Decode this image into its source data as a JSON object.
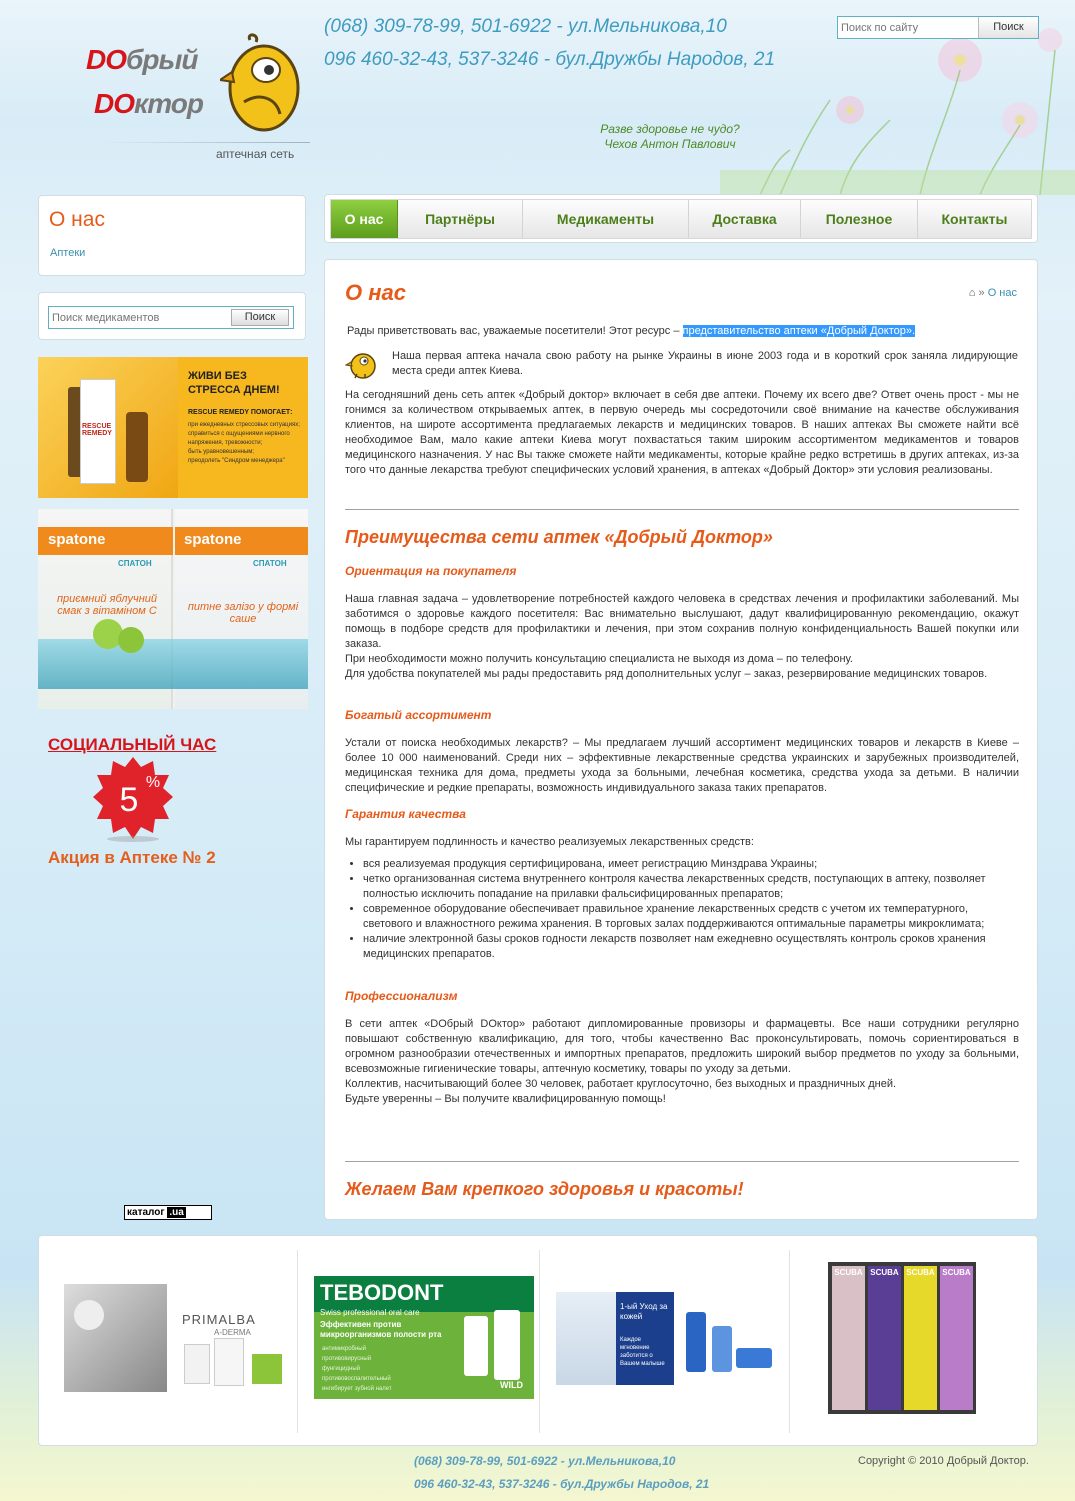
{
  "header": {
    "logo": {
      "line1_do": "DO",
      "line1_rest": "брый",
      "line2_do": "DO",
      "line2_rest": "ктор",
      "tagline": "аптечная сеть"
    },
    "phone_line1": "(068) 309-78-99, 501-6922 - ул.Мельникова,10",
    "phone_line2": "096 460-32-43, 537-3246 - бул.Дружбы Народов, 21",
    "quote_line1": "Разве здоровье не чудо?",
    "quote_line2": "Чехов Антон Павлович",
    "search": {
      "placeholder": "Поиск по сайту",
      "button": "Поиск"
    }
  },
  "nav": {
    "items": [
      {
        "label": "О нас",
        "active": true
      },
      {
        "label": "Партнёры"
      },
      {
        "label": "Медикаменты"
      },
      {
        "label": "Доставка"
      },
      {
        "label": "Полезное"
      },
      {
        "label": "Контакты"
      }
    ]
  },
  "sidebar": {
    "about_title": "О нас",
    "about_link": "Аптеки",
    "med_search": {
      "placeholder": "Поиск медикаментов",
      "button": "Поиск"
    },
    "rescue_banner": {
      "headline": "ЖИВИ БЕЗ СТРЕССА ДНЕМ!",
      "subhead": "RESCUE REMEDY ПОМОГАЕТ:",
      "bullets": [
        "при ежедневных стрессовых ситуациях;",
        "справиться с ощущениями нервного напряжения, тревожности;",
        "быть уравновешенным;",
        "преодолеть \"Синдром менеджера\""
      ],
      "pack_text": "RESCUE REMEDY"
    },
    "spatone_banner": {
      "brand": "spatone",
      "brand_cyr": "СПАТОН",
      "pack1": "приємний яблучний смак з вітаміном С",
      "pack2": "питне залізо у формі саше"
    },
    "social_title": "СОЦИАЛЬНЫЙ ЧАС",
    "discount_value": "5",
    "discount_unit": "%",
    "promo": "Акция в Аптеке № 2",
    "katalog": {
      "text": "каталог",
      "ua": ".ua"
    }
  },
  "content": {
    "title": "О нас",
    "breadcrumb_current": "О нас",
    "intro_plain": "Рады приветствовать вас, уважаемые посетители! Этот ресурс – ",
    "intro_highlight": "представительство аптеки «Добрый Доктор».",
    "first_pharmacy": "Наша первая аптека начала свою работу на рынке Украины в июне 2003 года и в короткий срок заняла лидирующие места среди аптек Киева.",
    "today": "На сегодняшний день сеть аптек «Добрый доктор» включает в себя две аптеки. Почему их всего две? Ответ очень прост - мы не гонимся за количеством открываемых аптек, в первую очередь мы сосредоточили своё внимание на качестве обслуживания клиентов, на широте ассортимента предлагаемых лекарств и медицинских товаров. В наших аптеках Вы сможете найти всё необходимое Вам, мало какие аптеки Киева могут похвастаться таким широким ассортиментом медикаментов и товаров медицинского назначения. У нас Вы также сможете найти медикаменты, которые крайне редко встретишь в других аптеках, из-за того что данные лекарства требуют специфических условий хранения, в аптеках «Добрый Доктор» эти условия реализованы.",
    "advantages_title": "Преимущества сети аптек «Добрый Доктор»",
    "s1_title": "Ориентация на покупателя",
    "s1_p1": "Наша главная задача – удовлетворение потребностей каждого человека в средствах лечения и профилактики заболеваний. Мы заботимся о здоровье каждого посетителя: Вас внимательно выслушают, дадут квалифицированную рекомендацию, окажут помощь в подборе средств для профилактики и лечения, при этом сохранив полную конфиденциальность Вашей покупки или заказа.",
    "s1_p2": "При необходимости можно получить консультацию специалиста не выходя из дома – по телефону.",
    "s1_p3": "Для удобства покупателей мы рады предоставить ряд дополнительных услуг – заказ, резервирование медицинских товаров.",
    "s2_title": "Богатый ассортимент",
    "s2_p1": "Устали от поиска необходимых лекарств? – Мы предлагаем лучший ассортимент медицинских товаров и лекарств в Киеве – более 10 000 наименований. Среди них – эффективные лекарственные средства украинских и зарубежных производителей, медицинская техника для дома, предметы ухода за больными, лечебная косметика, средства ухода за детьми. В наличии специфические и редкие препараты, возможность индивидуального заказа таких препаратов.",
    "s3_title": "Гарантия качества",
    "s3_p1": "Мы гарантируем подлинность и качество реализуемых лекарственных средств:",
    "s3_list": [
      "вся реализуемая продукция сертифицирована, имеет регистрацию Минздрава Украины;",
      "четко организованная система внутреннего контроля качества лекарственных средств, поступающих в аптеку, позволяет полностью исключить попадание на прилавки фальсифицированных препаратов;",
      "современное оборудование обеспечивает правильное хранение лекарственных средств с учетом их температурного, светового и влажностного режима хранения. В торговых залах поддерживаются оптимальные параметры микроклимата;",
      "наличие электронной базы сроков годности лекарств позволяет нам ежедневно осуществлять контроль сроков хранения медицинских препаратов."
    ],
    "s4_title": "Профессионализм",
    "s4_p1": "В сети аптек «DOбрый DOктор» работают дипломированные провизоры и фармацевты. Все наши сотрудники регулярно повышают собственную квалификацию, для того, чтобы качественно Вас проконсультировать, помочь сориентироваться в огромном разнообразии отечественных и импортных препаратов, предложить широкий выбор предметов по уходу за больными, всевозможные гигиенические товары, аптечную косметику, товары по уходу за детьми.",
    "s4_p2": "Коллектив, насчитывающий более 30 человек, работает круглосуточно, без выходных и праздничных дней.",
    "s4_p3": "Будьте уверенны – Вы получите квалифицированную помощь!",
    "closing": "Желаем Вам крепкого здоровья и красоты!"
  },
  "partners": {
    "primalba": {
      "brand": "PRIMALBA",
      "sub": "A-DERMA"
    },
    "tebodont": {
      "brand": "TEBODONT",
      "tag": "Swiss professional oral care",
      "headline": "Эффективен против микроорганизмов полости рта",
      "bullets": [
        "антимикробный",
        "противовирусный",
        "фунгицидный",
        "противовоспалительный",
        "ингибирует зубной налет"
      ],
      "wild": "WILD"
    },
    "baby": {
      "text1": "1-ый Уход за кожей",
      "text2": "Каждое мгновение заботится о Вашем малыше"
    },
    "scuba": {
      "brand": "SCUBA",
      "count": 4
    }
  },
  "footer": {
    "phone_line1": "(068) 309-78-99, 501-6922 - ул.Мельникова,10",
    "phone_line2": "096 460-32-43, 537-3246 - бул.Дружбы Народов, 21",
    "copyright": "Copyright © 2010 Добрый Доктор."
  }
}
